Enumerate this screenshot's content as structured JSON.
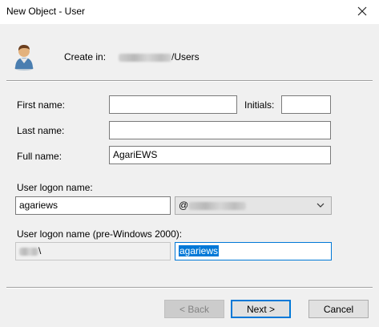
{
  "window": {
    "title": "New Object - User",
    "close_icon": "close-icon"
  },
  "header": {
    "icon": "user-icon",
    "create_in_label": "Create in:",
    "create_in_path_suffix": "/Users"
  },
  "form": {
    "first_name": {
      "label": "First name:",
      "value": ""
    },
    "initials": {
      "label": "Initials:",
      "value": ""
    },
    "last_name": {
      "label": "Last name:",
      "value": ""
    },
    "full_name": {
      "label": "Full name:",
      "value": "AgariEWS"
    },
    "logon_name": {
      "label": "User logon name:",
      "value": "agariews",
      "domain_prefix": "@"
    },
    "pre2000": {
      "label": "User logon name (pre-Windows 2000):",
      "domain_suffix": "\\",
      "value": "agariews"
    }
  },
  "buttons": {
    "back": "< Back",
    "next": "Next >",
    "cancel": "Cancel"
  },
  "colors": {
    "accent": "#0078d7",
    "dialog_bg": "#f0f0f0",
    "titlebar_bg": "#ffffff"
  }
}
